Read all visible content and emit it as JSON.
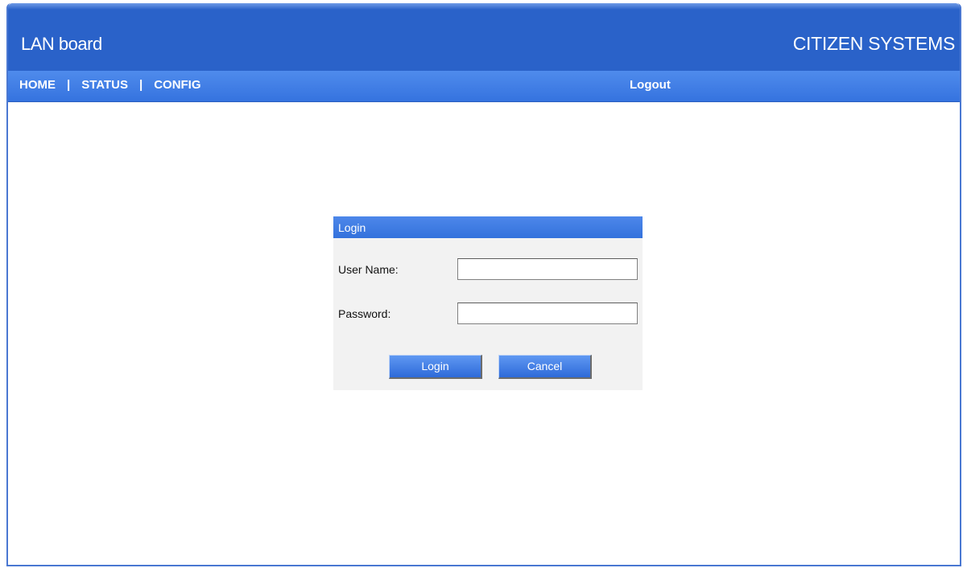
{
  "header": {
    "title": "LAN board",
    "brand": "CITIZEN SYSTEMS"
  },
  "nav": {
    "items": [
      {
        "label": "HOME"
      },
      {
        "label": "STATUS"
      },
      {
        "label": "CONFIG"
      }
    ],
    "separator": "|",
    "logout_label": "Logout"
  },
  "login": {
    "heading": "Login",
    "username_label": "User Name:",
    "username_value": "",
    "password_label": "Password:",
    "password_value": "",
    "login_button": "Login",
    "cancel_button": "Cancel"
  },
  "colors": {
    "header_blue": "#2a62c9",
    "nav_blue": "#3f7de5",
    "panel_gray": "#f2f2f2"
  }
}
